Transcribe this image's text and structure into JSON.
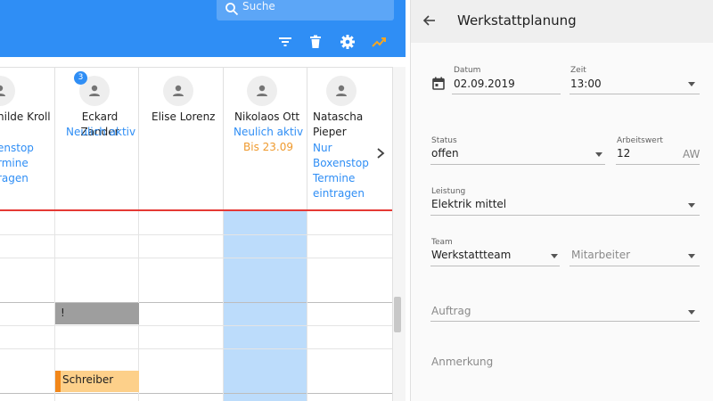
{
  "toolbar": {
    "search_placeholder": "Suche",
    "icons": [
      "search-icon",
      "filter-icon",
      "delete-icon",
      "settings-icon",
      "trending-up-icon"
    ],
    "accent": "#2f8ef5"
  },
  "columns": [
    {
      "name": "hilde Kroll",
      "status": [
        "enstop",
        "rmine",
        "ragen"
      ]
    },
    {
      "name": "Eckard Zander",
      "badge": "3",
      "status": [
        "Neulich aktiv"
      ]
    },
    {
      "name": "Elise Lorenz"
    },
    {
      "name": "Nikolaos Ott",
      "status": [
        "Neulich aktiv"
      ],
      "until": "Bis 23.09"
    },
    {
      "name_lines": [
        "Natascha",
        "Pieper"
      ],
      "status": [
        "Nur",
        "Boxenstop",
        "Termine",
        "eintragen"
      ]
    }
  ],
  "blocks": {
    "gray_label": "!",
    "orange_label": "Schreiber"
  },
  "panel": {
    "title": "Werkstattplanung",
    "datum": {
      "label": "Datum",
      "value": "02.09.2019"
    },
    "zeit": {
      "label": "Zeit",
      "value": "13:00"
    },
    "status": {
      "label": "Status",
      "value": "offen"
    },
    "arbeitswert": {
      "label": "Arbeitswert",
      "value": "12",
      "unit": "AW"
    },
    "leistung": {
      "label": "Leistung",
      "value": "Elektrik mittel"
    },
    "team": {
      "label": "Team",
      "value": "Werkstattteam"
    },
    "mitarbeiter": {
      "placeholder": "Mitarbeiter"
    },
    "auftrag": {
      "placeholder": "Auftrag"
    },
    "anmerkung": {
      "placeholder": "Anmerkung"
    }
  }
}
